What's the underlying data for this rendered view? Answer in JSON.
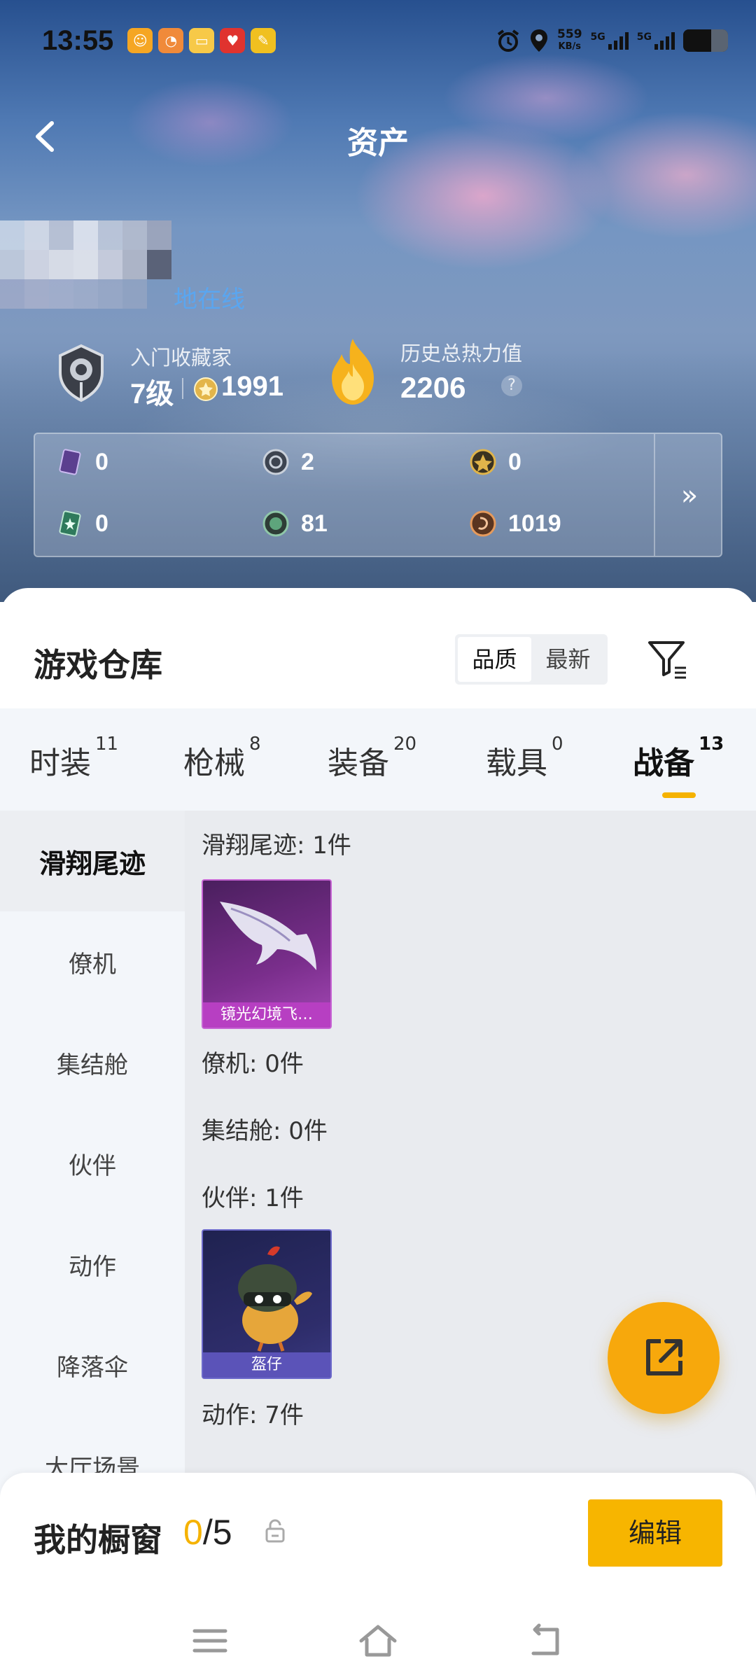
{
  "status_bar": {
    "time": "13:55",
    "net_speed": "559",
    "net_unit": "KB/s",
    "sim1": "5G",
    "sim2": "5G"
  },
  "header": {
    "title": "资产"
  },
  "profile": {
    "online_text": "地在线",
    "rank_label": "入门收藏家",
    "rank_level": "7级",
    "coins": "1991",
    "heat_label": "历史总热力值",
    "heat_value": "2206",
    "help": "?"
  },
  "resources": [
    {
      "icon": "purple-card-icon",
      "value": "0"
    },
    {
      "icon": "silver-coin-icon",
      "value": "2"
    },
    {
      "icon": "gold-coin-icon",
      "value": "0"
    },
    {
      "icon": "green-card-icon",
      "value": "0"
    },
    {
      "icon": "green-orb-icon",
      "value": "81"
    },
    {
      "icon": "bronze-coin-icon",
      "value": "1019"
    }
  ],
  "resources_more": "»",
  "warehouse": {
    "title": "游戏仓库",
    "sort": [
      "品质",
      "最新"
    ],
    "sort_active": "品质"
  },
  "tabs": [
    {
      "label": "时装",
      "count": "11"
    },
    {
      "label": "枪械",
      "count": "8"
    },
    {
      "label": "装备",
      "count": "20"
    },
    {
      "label": "载具",
      "count": "0"
    },
    {
      "label": "战备",
      "count": "13"
    }
  ],
  "active_tab": "战备",
  "sidebar": [
    "滑翔尾迹",
    "僚机",
    "集结舱",
    "伙伴",
    "动作",
    "降落伞",
    "大厅场景"
  ],
  "sections": {
    "trail": "滑翔尾迹: 1件",
    "trail_item": "镜光幻境飞…",
    "wingman": "僚机: 0件",
    "pod": "集结舱: 0件",
    "partner": "伙伴: 1件",
    "partner_item": "盔仔",
    "emote": "动作: 7件"
  },
  "showcase": {
    "title": "我的橱窗",
    "current": "0",
    "total": "/5",
    "edit": "编辑"
  },
  "colors": {
    "accent": "#f5b200",
    "online": "#5aa6f0",
    "purple_card": "#8a2aa0",
    "navy_card": "#2b2a63"
  }
}
